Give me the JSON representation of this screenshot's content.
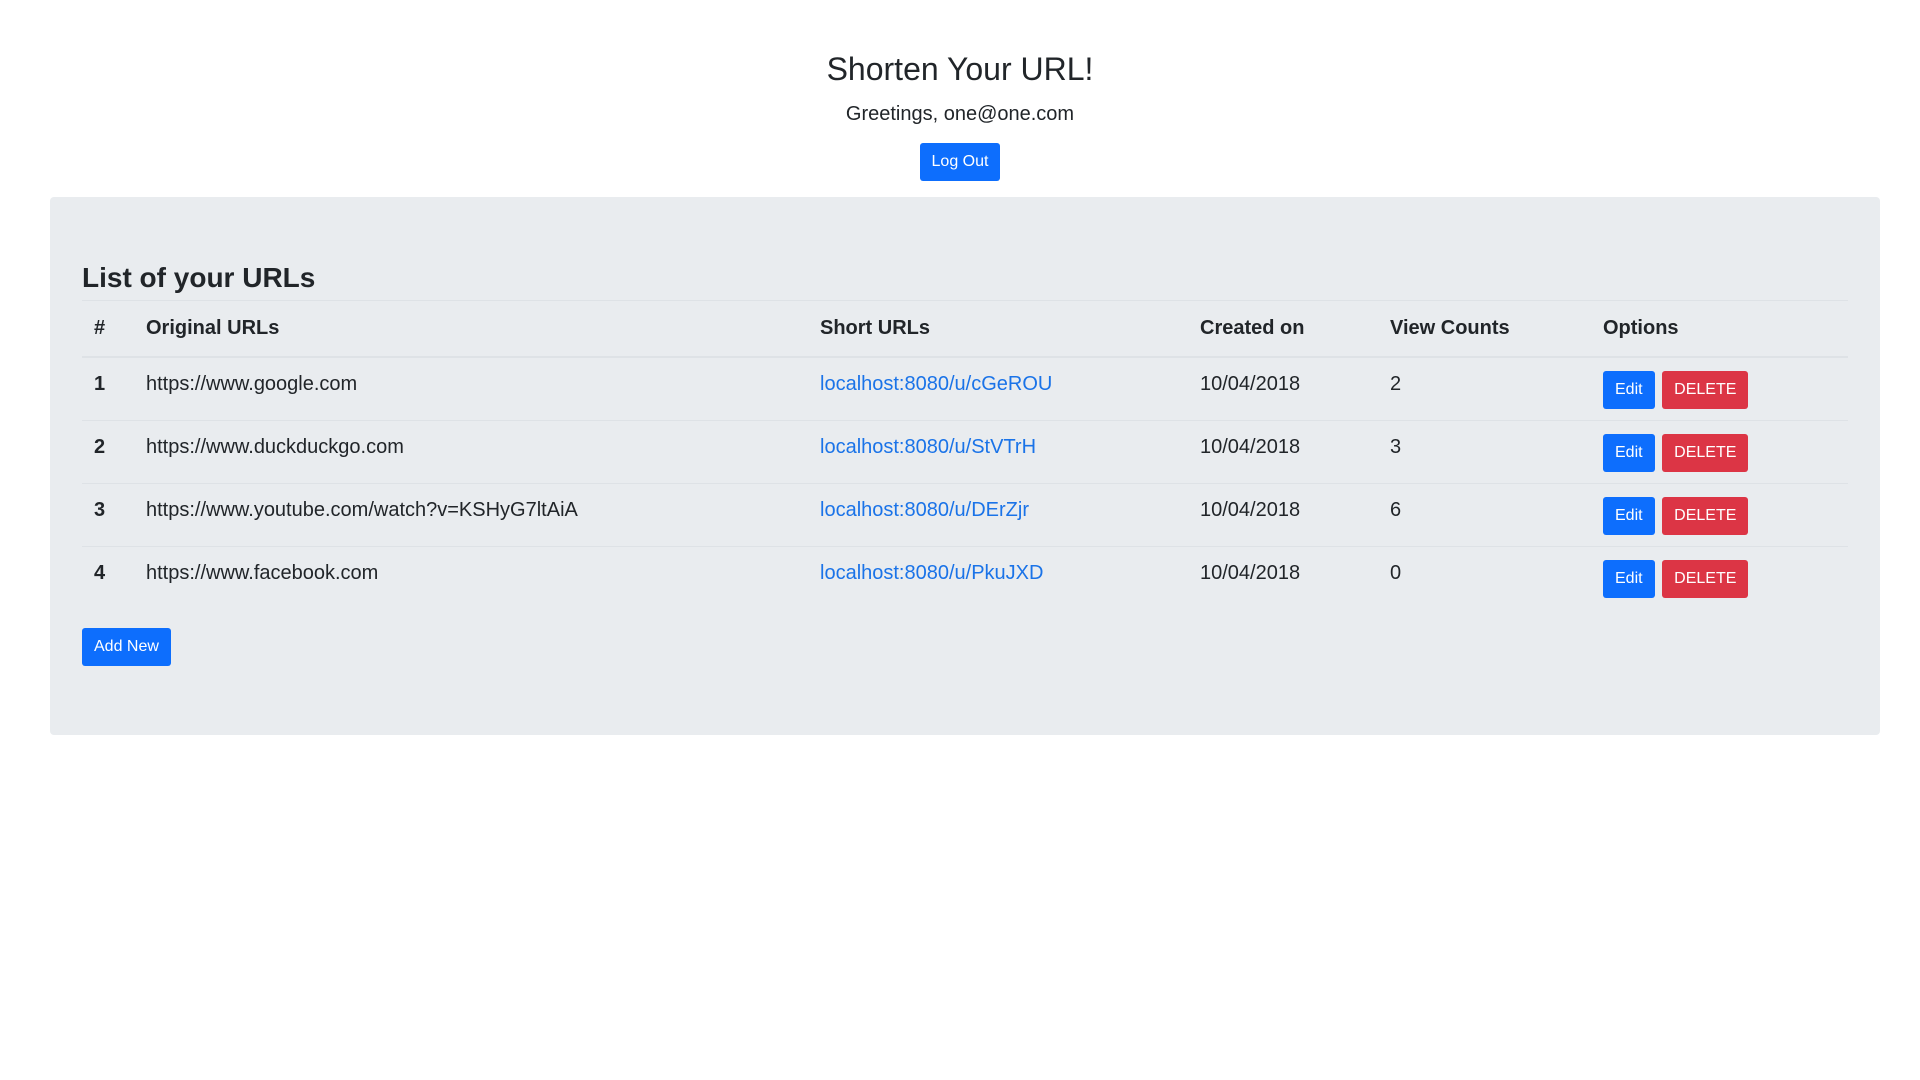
{
  "header": {
    "title": "Shorten Your URL!",
    "greeting": "Greetings, one@one.com",
    "logout_label": "Log Out"
  },
  "list": {
    "title": "List of your URLs",
    "columns": {
      "num": "#",
      "original": "Original URLs",
      "short": "Short URLs",
      "created": "Created on",
      "views": "View Counts",
      "options": "Options"
    },
    "rows": [
      {
        "num": "1",
        "original": "https://www.google.com",
        "short": "localhost:8080/u/cGeROU",
        "created": "10/04/2018",
        "views": "2"
      },
      {
        "num": "2",
        "original": "https://www.duckduckgo.com",
        "short": "localhost:8080/u/StVTrH",
        "created": "10/04/2018",
        "views": "3"
      },
      {
        "num": "3",
        "original": "https://www.youtube.com/watch?v=KSHyG7ltAiA",
        "short": "localhost:8080/u/DErZjr",
        "created": "10/04/2018",
        "views": "6"
      },
      {
        "num": "4",
        "original": "https://www.facebook.com",
        "short": "localhost:8080/u/PkuJXD",
        "created": "10/04/2018",
        "views": "0"
      }
    ],
    "edit_label": "Edit",
    "delete_label": "DELETE",
    "add_new_label": "Add New"
  },
  "colors": {
    "primary": "#0d6efd",
    "danger": "#dc3545",
    "panel_bg": "#e9ecef",
    "link": "#1a73e8"
  }
}
